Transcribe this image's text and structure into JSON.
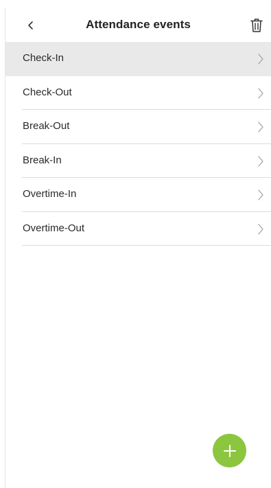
{
  "header": {
    "title": "Attendance events",
    "back_icon": "chevron-left-icon",
    "delete_icon": "trash-icon"
  },
  "events": [
    {
      "label": "Check-In",
      "selected": true
    },
    {
      "label": "Check-Out",
      "selected": false
    },
    {
      "label": "Break-Out",
      "selected": false
    },
    {
      "label": "Break-In",
      "selected": false
    },
    {
      "label": "Overtime-In",
      "selected": false
    },
    {
      "label": "Overtime-Out",
      "selected": false
    }
  ],
  "fab": {
    "icon": "plus-icon",
    "color": "#8cc63f"
  },
  "colors": {
    "selected_row": "#e9e9e9",
    "divider": "#dcdcdc"
  }
}
